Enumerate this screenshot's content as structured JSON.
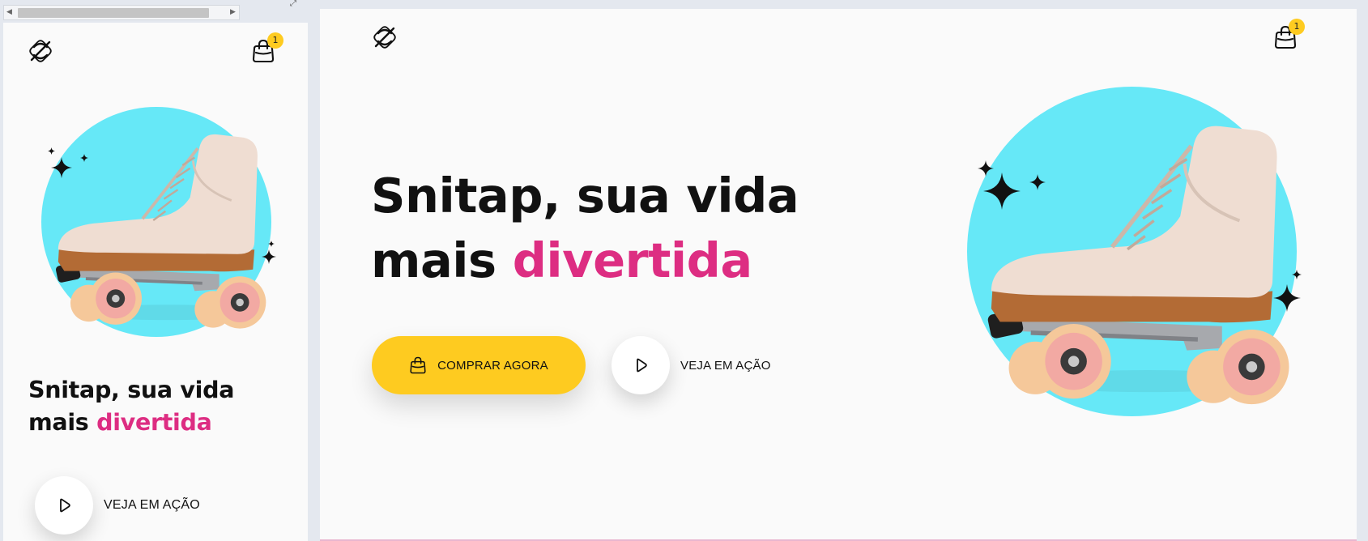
{
  "colors": {
    "accent_pink": "#dd2d82",
    "button_yellow": "#fecb20",
    "circle_cyan": "#66e8f7",
    "page_background": "#fafafa"
  },
  "icons": {
    "scrollbar_left": "◀",
    "scrollbar_right": "▶",
    "expand": "⤢",
    "logo": "snitap-logo-icon",
    "bag": "shopping-bag-icon",
    "play": "play-icon",
    "sparkle": "sparkle-icon"
  },
  "header": {
    "cart_count": "1"
  },
  "hero": {
    "title_line1": "Snitap, sua vida",
    "title_line2_prefix": "mais",
    "title_accent": "divertida",
    "buy_button_label": "COMPRAR AGORA",
    "watch_button_label": "VEJA EM AÇÃO"
  }
}
